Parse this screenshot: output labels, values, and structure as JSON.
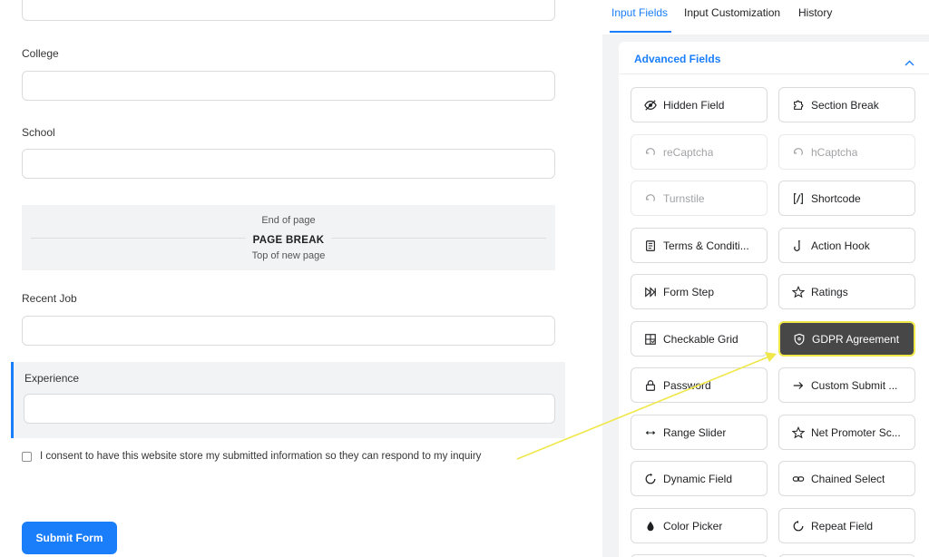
{
  "form": {
    "labels": {
      "college": "College",
      "school": "School",
      "recent_job": "Recent Job",
      "experience": "Experience"
    },
    "page_break": {
      "end": "End of page",
      "title": "PAGE BREAK",
      "top": "Top of new page"
    },
    "consent": "I consent to have this website store my submitted information so they can respond to my inquiry",
    "submit": "Submit Form"
  },
  "panel": {
    "tabs": [
      "Input Fields",
      "Input Customization",
      "History"
    ],
    "section_title": "Advanced Fields",
    "fields": [
      {
        "label": "Hidden Field",
        "icon": "eye-slash-icon"
      },
      {
        "label": "Section Break",
        "icon": "puzzle-icon"
      },
      {
        "label": "reCaptcha",
        "icon": "recaptcha-icon"
      },
      {
        "label": "hCaptcha",
        "icon": "hcaptcha-icon"
      },
      {
        "label": "Turnstile",
        "icon": "turnstile-icon"
      },
      {
        "label": "Shortcode",
        "icon": "shortcode-icon"
      },
      {
        "label": "Terms & Conditi...",
        "icon": "document-icon"
      },
      {
        "label": "Action Hook",
        "icon": "hook-icon"
      },
      {
        "label": "Form Step",
        "icon": "fast-forward-icon"
      },
      {
        "label": "Ratings",
        "icon": "star-icon"
      },
      {
        "label": "Checkable Grid",
        "icon": "grid-check-icon"
      },
      {
        "label": "GDPR Agreement",
        "icon": "shield-icon"
      },
      {
        "label": "Password",
        "icon": "lock-icon"
      },
      {
        "label": "Custom Submit ...",
        "icon": "arrow-right-icon"
      },
      {
        "label": "Range Slider",
        "icon": "range-icon"
      },
      {
        "label": "Net Promoter Sc...",
        "icon": "star-outline-icon"
      },
      {
        "label": "Dynamic Field",
        "icon": "refresh-icon"
      },
      {
        "label": "Chained Select",
        "icon": "chain-icon"
      },
      {
        "label": "Color Picker",
        "icon": "drop-icon"
      },
      {
        "label": "Repeat Field",
        "icon": "repeat-icon"
      }
    ]
  },
  "colors": {
    "accent": "#1a7efb",
    "highlight_bg": "#474747",
    "highlight_border": "#f0e74a",
    "arrow": "#f0e74a"
  }
}
